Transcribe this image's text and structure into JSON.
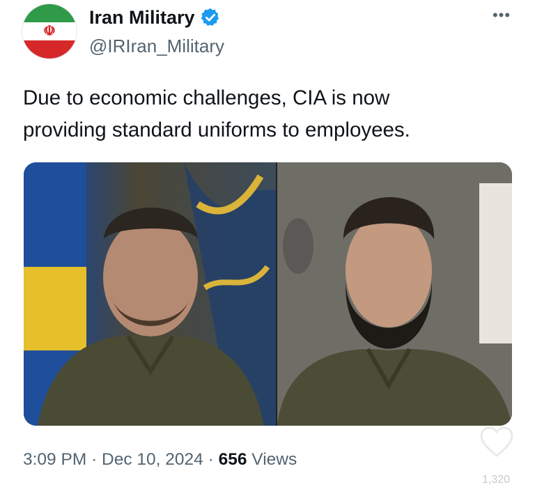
{
  "author": {
    "display_name": "Iran Military",
    "handle": "@IRIran_Military",
    "verified": true,
    "avatar_icon": "iran-flag-avatar",
    "verified_icon": "verified-badge-icon",
    "verified_color": "#1d9bf0"
  },
  "more_icon": "more-horizontal-icon",
  "tweet": {
    "text_line1": "Due to economic challenges, CIA is now",
    "text_line2": "providing standard uniforms to employees."
  },
  "media": {
    "left_photo": "photo-man-olive-shirt-flag-background",
    "right_photo": "photo-bearded-man-olive-shirt"
  },
  "meta": {
    "time": "3:09 PM",
    "separator": "·",
    "date": "Dec 10, 2024",
    "views_count": "656",
    "views_label": "Views"
  },
  "overlay": {
    "like_icon": "heart-outline-icon",
    "like_count": "1,320"
  }
}
